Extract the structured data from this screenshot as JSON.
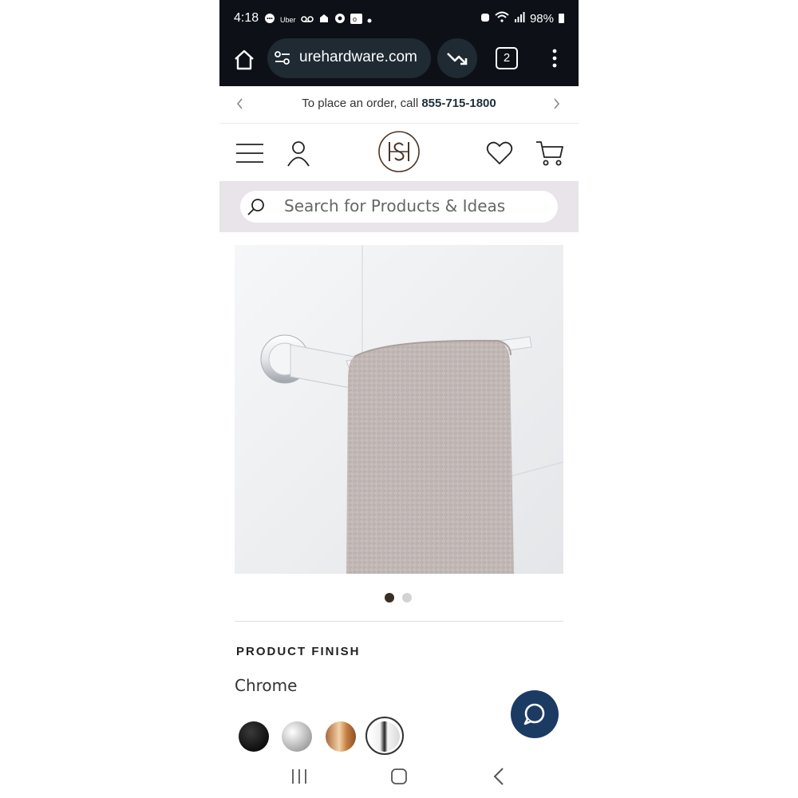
{
  "status": {
    "time": "4:18",
    "left_icons": [
      "messages-icon",
      "uber-icon",
      "voicemail-icon",
      "app-icon",
      "app-icon",
      "outlook-icon",
      "dot"
    ],
    "uber_text": "Uber",
    "battery": "98%"
  },
  "browser": {
    "url": "urehardware.com",
    "tab_count": "2"
  },
  "promo": {
    "text": "To place an order, call ",
    "phone": "855-715-1800"
  },
  "header": {
    "logo_text": "SH"
  },
  "search": {
    "placeholder": "Search for Products & Ideas"
  },
  "gallery": {
    "slide_count": 2,
    "active_slide": 1
  },
  "product": {
    "finish_heading": "PRODUCT FINISH",
    "finish_value": "Chrome",
    "swatches": [
      "Matte Black",
      "Brushed Nickel",
      "Brushed Gold",
      "Chrome"
    ],
    "selected_swatch": "Chrome"
  },
  "colors": {
    "browser_bg": "#0d1117",
    "search_band": "#e9e3ea",
    "chat_button": "#1c3b63",
    "logo_brown": "#4a3425"
  }
}
